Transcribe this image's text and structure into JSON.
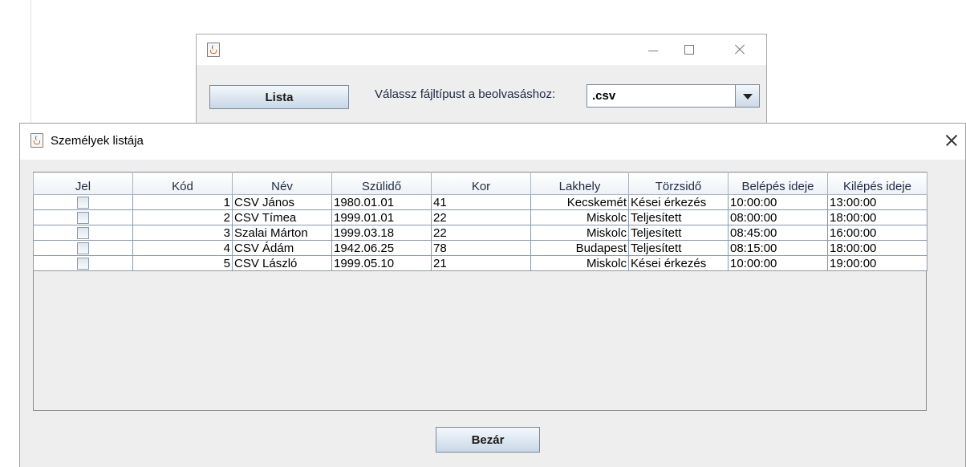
{
  "back_window": {
    "list_button": "Lista",
    "filetype_label": "Válassz fájltípust a beolvasáshoz:",
    "filetype_selected": ".csv"
  },
  "front_window": {
    "title": "Személyek listája",
    "close_button": "Bezár",
    "table": {
      "columns": [
        "Jel",
        "Kód",
        "Név",
        "Szülidő",
        "Kor",
        "Lakhely",
        "Törzsidő",
        "Belépés ideje",
        "Kilépés ideje"
      ],
      "rows": [
        {
          "checked": false,
          "kod": "1",
          "nev": "CSV János",
          "szulido": "1980.01.01",
          "kor": "41",
          "lakhely": "Kecskemét",
          "torzsido": "Kései érkezés",
          "belepes": "10:00:00",
          "kilepes": "13:00:00"
        },
        {
          "checked": false,
          "kod": "2",
          "nev": "CSV Tímea",
          "szulido": "1999.01.01",
          "kor": "22",
          "lakhely": "Miskolc",
          "torzsido": "Teljesített",
          "belepes": "08:00:00",
          "kilepes": "18:00:00"
        },
        {
          "checked": false,
          "kod": "3",
          "nev": "Szalai Márton",
          "szulido": "1999.03.18",
          "kor": "22",
          "lakhely": "Miskolc",
          "torzsido": "Teljesített",
          "belepes": "08:45:00",
          "kilepes": "16:00:00"
        },
        {
          "checked": false,
          "kod": "4",
          "nev": "CSV Ádám",
          "szulido": "1942.06.25",
          "kor": "78",
          "lakhely": "Budapest",
          "torzsido": "Teljesített",
          "belepes": "08:15:00",
          "kilepes": "18:00:00"
        },
        {
          "checked": false,
          "kod": "5",
          "nev": "CSV László",
          "szulido": "1999.05.10",
          "kor": "21",
          "lakhely": "Miskolc",
          "torzsido": "Kései érkezés",
          "belepes": "10:00:00",
          "kilepes": "19:00:00"
        }
      ]
    }
  },
  "icons": {
    "app_icon": "java-icon",
    "minimize": "minimize-icon",
    "maximize": "maximize-icon",
    "close": "close-icon",
    "dropdown": "chevron-down-icon"
  }
}
